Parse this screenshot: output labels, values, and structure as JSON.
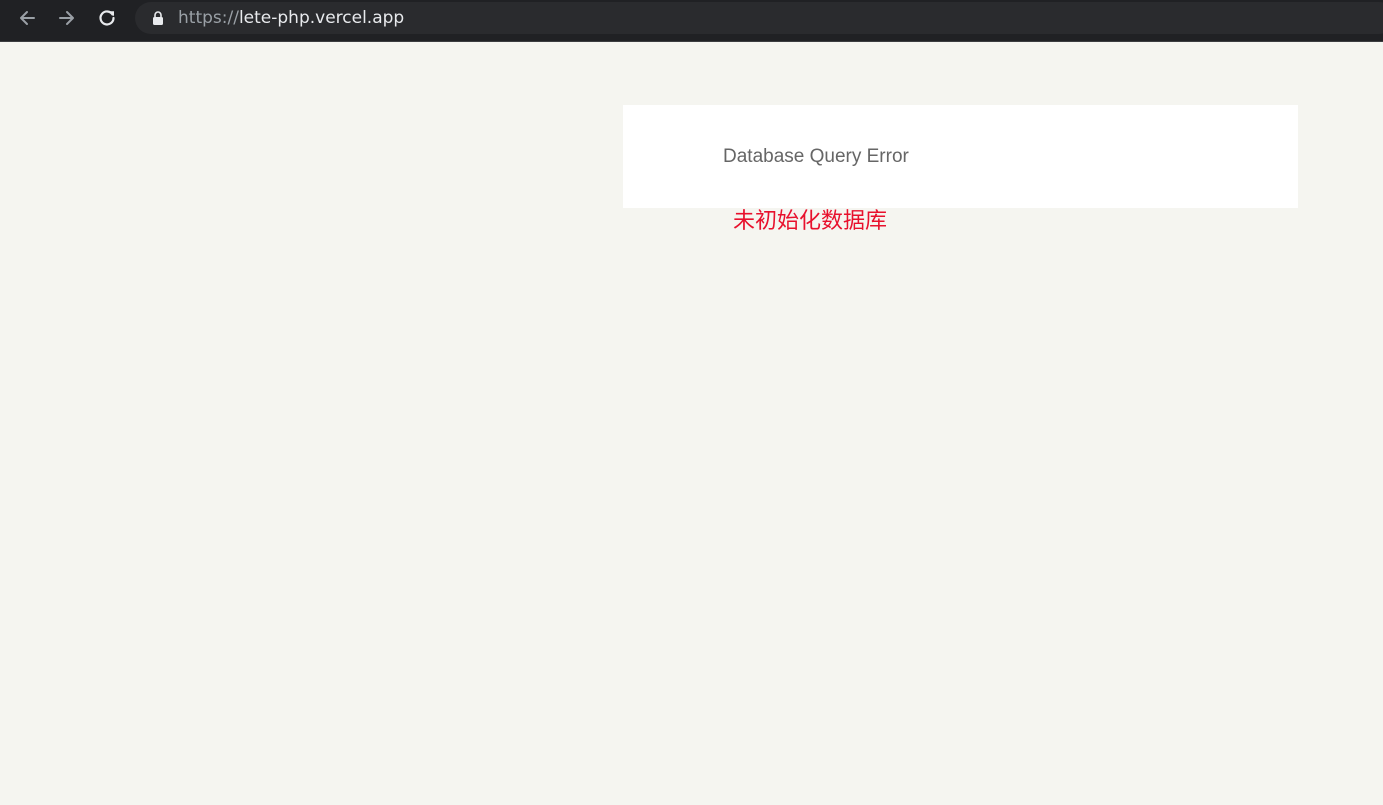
{
  "browser": {
    "url_scheme": "https://",
    "url_host": "lete-php.vercel.app",
    "icons": {
      "back": "arrow-left-icon",
      "forward": "arrow-right-icon",
      "reload": "reload-icon",
      "lock": "lock-icon"
    }
  },
  "page": {
    "error_title": "Database Query Error",
    "error_message": "未初始化数据库"
  },
  "colors": {
    "background": "#f5f5f0",
    "panel": "#ffffff",
    "title_text": "#666666",
    "error_text": "#e8112d",
    "toolbar": "#202124"
  }
}
